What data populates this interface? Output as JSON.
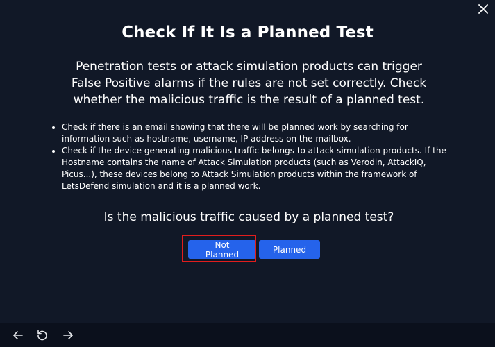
{
  "dialog": {
    "title": "Check If It Is a Planned Test",
    "intro": "Penetration tests or attack simulation products can trigger False Positive alarms if the rules are not set correctly. Check whether the malicious traffic is the result of a planned test.",
    "steps": [
      "Check if there is an email showing that there will be planned work by searching for information such as hostname, username, IP address on the mailbox.",
      "Check if the device generating malicious traffic belongs to attack simulation products. If the Hostname contains the name of Attack Simulation products (such as Verodin, AttackIQ, Picus...), these devices belong to Attack Simulation products within the framework of LetsDefend simulation and it is a planned work."
    ],
    "question": "Is the malicious traffic caused by a planned test?",
    "buttons": {
      "not_planned": "Not Planned",
      "planned": "Planned"
    },
    "highlighted_option": "Not Planned"
  },
  "icons": {
    "close": "close-icon",
    "back": "arrow-left-icon",
    "reset": "rotate-ccw-icon",
    "forward": "arrow-right-icon"
  },
  "colors": {
    "background": "#111827",
    "footer": "#0b101c",
    "button": "#2563eb",
    "highlight": "#e11d1d"
  }
}
